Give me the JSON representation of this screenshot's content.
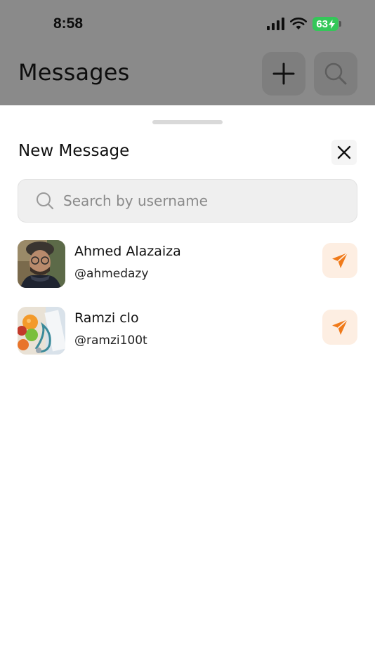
{
  "status_bar": {
    "time": "8:58",
    "battery": "63"
  },
  "background_screen": {
    "title": "Messages",
    "add_icon": "plus-icon",
    "search_icon": "search-icon"
  },
  "sheet": {
    "title": "New Message",
    "close_icon": "close-icon",
    "search": {
      "placeholder": "Search by username",
      "value": ""
    },
    "users": [
      {
        "name": "Ahmed Alazaiza",
        "handle": "@ahmedazy",
        "action_icon": "send-icon"
      },
      {
        "name": "Ramzi clo",
        "handle": "@ramzi100t",
        "action_icon": "send-icon"
      }
    ]
  },
  "colors": {
    "accent": "#f07a1a",
    "accent_bg": "#fdeee2",
    "battery": "#34c759",
    "dim_overlay": "#8a8a8a"
  }
}
